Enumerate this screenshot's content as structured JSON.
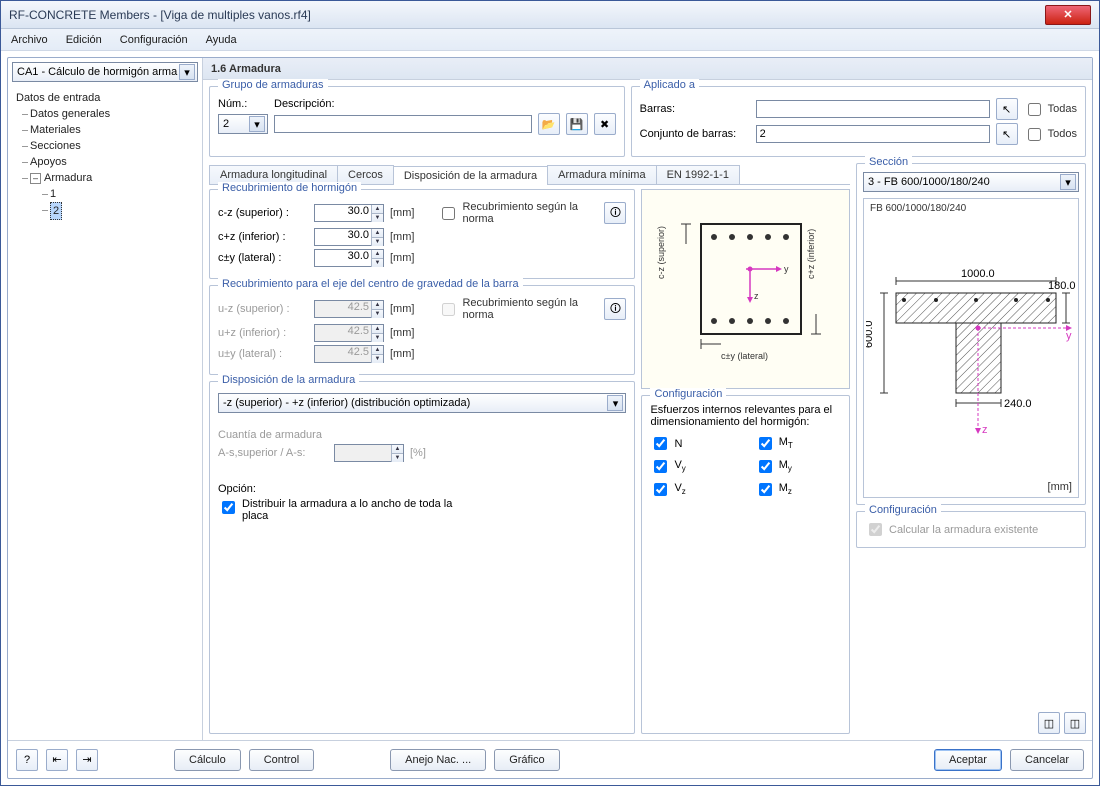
{
  "window": {
    "title": "RF-CONCRETE Members - [Viga de multiples vanos.rf4]"
  },
  "menu": {
    "archivo": "Archivo",
    "edicion": "Edición",
    "config": "Configuración",
    "ayuda": "Ayuda"
  },
  "sidebar": {
    "combo": "CA1 - Cálculo de hormigón arma",
    "tree": {
      "root": "Datos de entrada",
      "items": [
        "Datos generales",
        "Materiales",
        "Secciones",
        "Apoyos"
      ],
      "armadura": "Armadura",
      "armadura_children": [
        "1",
        "2"
      ]
    }
  },
  "header": "1.6 Armadura",
  "grupo": {
    "legend": "Grupo de armaduras",
    "num_label": "Núm.:",
    "num_value": "2",
    "desc_label": "Descripción:",
    "desc_value": ""
  },
  "aplicado": {
    "legend": "Aplicado a",
    "barras_label": "Barras:",
    "barras_value": "",
    "todas": "Todas",
    "conjunto_label": "Conjunto de barras:",
    "conjunto_value": "2",
    "todos": "Todos"
  },
  "tabs": {
    "t1": "Armadura longitudinal",
    "t2": "Cercos",
    "t3": "Disposición de la armadura",
    "t4": "Armadura mínima",
    "t5": "EN 1992-1-1"
  },
  "recub": {
    "legend": "Recubrimiento de hormigón",
    "cz_sup": "c-z (superior) :",
    "cz_inf": "c+z (inferior) :",
    "cy_lat": "c±y (lateral) :",
    "v1": "30.0",
    "v2": "30.0",
    "v3": "30.0",
    "unit": "[mm]",
    "norma": "Recubrimiento según la norma"
  },
  "recub_centro": {
    "legend": "Recubrimiento para el eje del centro de gravedad de la barra",
    "uz_sup": "u-z (superior) :",
    "uz_inf": "u+z (inferior) :",
    "uy_lat": "u±y (lateral) :",
    "v1": "42.5",
    "v2": "42.5",
    "v3": "42.5",
    "unit": "[mm]",
    "norma": "Recubrimiento según la norma"
  },
  "dispo": {
    "legend": "Disposición de la armadura",
    "select": "-z (superior) - +z (inferior) (distribución optimizada)",
    "cuantia_l1": "Cuantía de armadura",
    "cuantia_l2": "A-s,superior / A-s:",
    "cuantia_unit": "[%]",
    "opcion": "Opción:",
    "distribuir": "Distribuir la armadura a lo ancho de toda la placa"
  },
  "config": {
    "legend": "Configuración",
    "desc": "Esfuerzos internos relevantes para el dimensionamiento del hormigón:",
    "N": "N",
    "MT": "MT",
    "Vy": "Vy",
    "My": "My",
    "Vz": "Vz",
    "Mz": "Mz"
  },
  "seccion": {
    "legend": "Sección",
    "select": "3 - FB 600/1000/180/240",
    "title": "FB 600/1000/180/240",
    "mm": "[mm]",
    "d1": "1000.0",
    "d2": "180.0",
    "d3": "600.0",
    "d4": "240.0",
    "y": "y",
    "z": "z"
  },
  "seccion_cfg": {
    "legend": "Configuración",
    "calc": "Calcular la armadura existente"
  },
  "cross": {
    "cz_sup": "c-z (superior)",
    "cz_inf": "c+z (inferior)",
    "cy_lat": "c±y (lateral)",
    "y": "y",
    "z": "z"
  },
  "footer": {
    "calculo": "Cálculo",
    "control": "Control",
    "anejo": "Anejo Nac. ...",
    "grafico": "Gráfico",
    "aceptar": "Aceptar",
    "cancelar": "Cancelar"
  }
}
